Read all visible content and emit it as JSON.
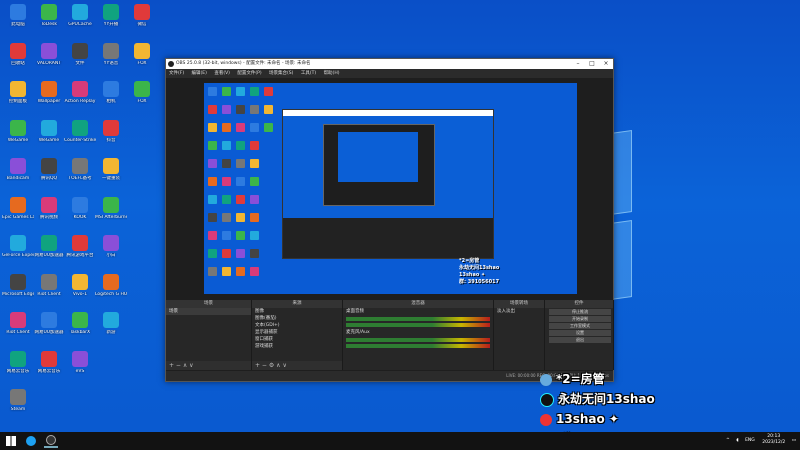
{
  "desktop": {
    "icons_col1": [
      "此电脑",
      "回收站",
      "控制面板",
      "WeGame",
      "Bandicam",
      "Epic Games Launcher",
      "GeForce Experience",
      "Microsoft Edge",
      "Riot Client",
      "网易云音乐",
      "Steam"
    ],
    "icons_col2": [
      "ToDesk",
      "VALORANT",
      "Wallpaper",
      "WeGame",
      "腾讯QQ",
      "腾讯视频",
      "网易UU加速器",
      "Riot Client",
      "网易UU加速器",
      "网易云音乐"
    ],
    "icons_col3": [
      "GPUCache",
      "文件",
      "Action Replay",
      "Counter-Strike Global Off...",
      "TOEFL备考",
      "KOOK",
      "腾讯游戏平台",
      "Vivo-1",
      "TaskbarX",
      "eVS"
    ],
    "icons_col4": [
      "YY开播",
      "YY语音",
      "相机",
      "抖音",
      "一键重装",
      "MSI Afterburner",
      "小白",
      "Logitech G HUB",
      "新游"
    ],
    "icons_col5": [
      "微信",
      "FOX",
      "FOX"
    ]
  },
  "obs": {
    "title": "OBS 25.0.8 (32-bit, windows) - 配置文件: 未命名 - 场景: 未命名",
    "menu": [
      "文件(F)",
      "编辑(E)",
      "查看(V)",
      "配置文件(P)",
      "场景集合(S)",
      "工具(T)",
      "帮助(H)"
    ],
    "docks": {
      "scenes": {
        "title": "场景",
        "items": [
          "场景"
        ]
      },
      "sources": {
        "title": "来源",
        "items": [
          "图像",
          "图像(番茄)",
          "文本(GDI+)",
          "显示器捕获",
          "窗口捕获",
          "游戏捕获"
        ]
      },
      "mixer": {
        "title": "混音器",
        "channels": [
          {
            "name": "桌面音频",
            "db": "0.0 dB"
          },
          {
            "name": "麦克风/Aux",
            "db": "0.0 dB"
          }
        ]
      },
      "transitions": {
        "title": "场景转场",
        "type": "淡入淡出"
      },
      "controls": {
        "title": "控件",
        "buttons": [
          "停止推流",
          "开始录制",
          "工作室模式",
          "设置",
          "退出"
        ]
      }
    },
    "status": "LIVE: 00:00:00    REC: 00:00:00    CPU: 1.7%, 30.00 fps"
  },
  "overlay": {
    "line1": "*2=房管",
    "line2": "永劫无间13shao",
    "line3": "13shao ✦",
    "line4": "群: 391056017"
  },
  "taskbar": {
    "lang": "ENG",
    "time": "20:13",
    "date": "2023/12/2"
  }
}
